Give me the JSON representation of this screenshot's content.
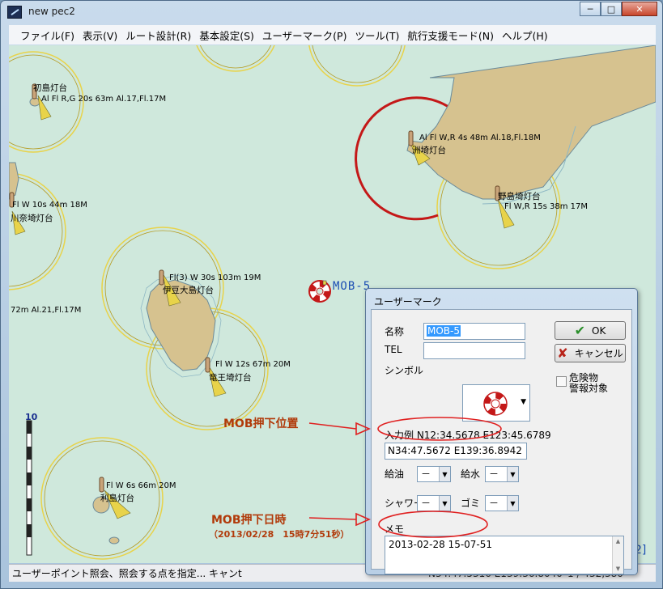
{
  "window": {
    "title": "new pec2",
    "minimize_label": "─",
    "maximize_label": "□",
    "close_label": "✕"
  },
  "menu": {
    "items": [
      {
        "label": "ファイル(F)"
      },
      {
        "label": "表示(V)"
      },
      {
        "label": "ルート設計(R)"
      },
      {
        "label": "基本設定(S)"
      },
      {
        "label": "ユーザーマーク(P)"
      },
      {
        "label": "ツール(T)"
      },
      {
        "label": "航行支援モード(N)"
      },
      {
        "label": "ヘルプ(H)"
      }
    ]
  },
  "map": {
    "labels": {
      "hatsushima_name": "初島灯台",
      "hatsushima_light": "Al Fl R,G 20s 63m Al.17,Fl.17M",
      "suzaki_light": "Al Fl W,R 4s 48m Al.18,Fl.18M",
      "suzaki_name": "洲埼灯台",
      "nojima_name": "野島埼灯台",
      "nojima_light": "Fl W,R 15s 38m 17M",
      "kawana_light": "Fl W 10s 44m 18M",
      "kawana_name": "川奈埼灯台",
      "oshima_light": "Fl(3) W 30s 103m 19M",
      "oshima_name": "伊豆大島灯台",
      "left_partial": "72m Al.21,Fl.17M",
      "ryuo_light": "Fl W 12s 67m 20M",
      "ryuo_name": "竜王埼灯台",
      "toshima_light": "Fl W 6s 66m 20M",
      "toshima_name": "利島灯台",
      "mob": "MOB-5"
    },
    "scale_number": "10"
  },
  "dialog": {
    "title": "ユーザーマーク",
    "name_label": "名称",
    "name_value": "MOB-5",
    "tel_label": "TEL",
    "tel_value": "",
    "symbol_label": "シンボル",
    "danger_line1": "危険物",
    "danger_line2": "警報対象",
    "ok_label": "OK",
    "cancel_label": "キャンセル",
    "example_label": "入力例 N12:34.5678  E123:45.6789",
    "position_value": "N34:47.5672  E139:36.8942",
    "fuel_label": "給油",
    "fuel_value": "－",
    "water_label": "給水",
    "water_value": "－",
    "shower_label": "シャワー",
    "shower_value": "－",
    "trash_label": "ゴミ",
    "trash_value": "－",
    "memo_label": "メモ",
    "memo_value": "2013-02-28 15-07-51"
  },
  "annotations": {
    "position": "MOB押下位置",
    "datetime": "MOB押下日時",
    "datetime_detail": "（2013/02/28　15時7分51秒）"
  },
  "status": {
    "text": "ユーザーポイント照会、照会する点を指定...   キャンt",
    "coord": "N34:47.5316  E139:36.8040",
    "scale": "1 / 432,380",
    "tail": "2]"
  },
  "colors": {
    "sea": "#cfe8dc",
    "land": "#d6c28f",
    "coast": "#6a8a9a",
    "light_sector_yellow": "#e8d34a",
    "light_sector_red": "#c41818",
    "annotation": "#b13a0a",
    "mob_blue": "#1a4db3"
  },
  "icons": [
    "app-icon",
    "ok-check-icon",
    "cancel-x-icon",
    "life-ring-icon",
    "lighthouse-icon"
  ]
}
